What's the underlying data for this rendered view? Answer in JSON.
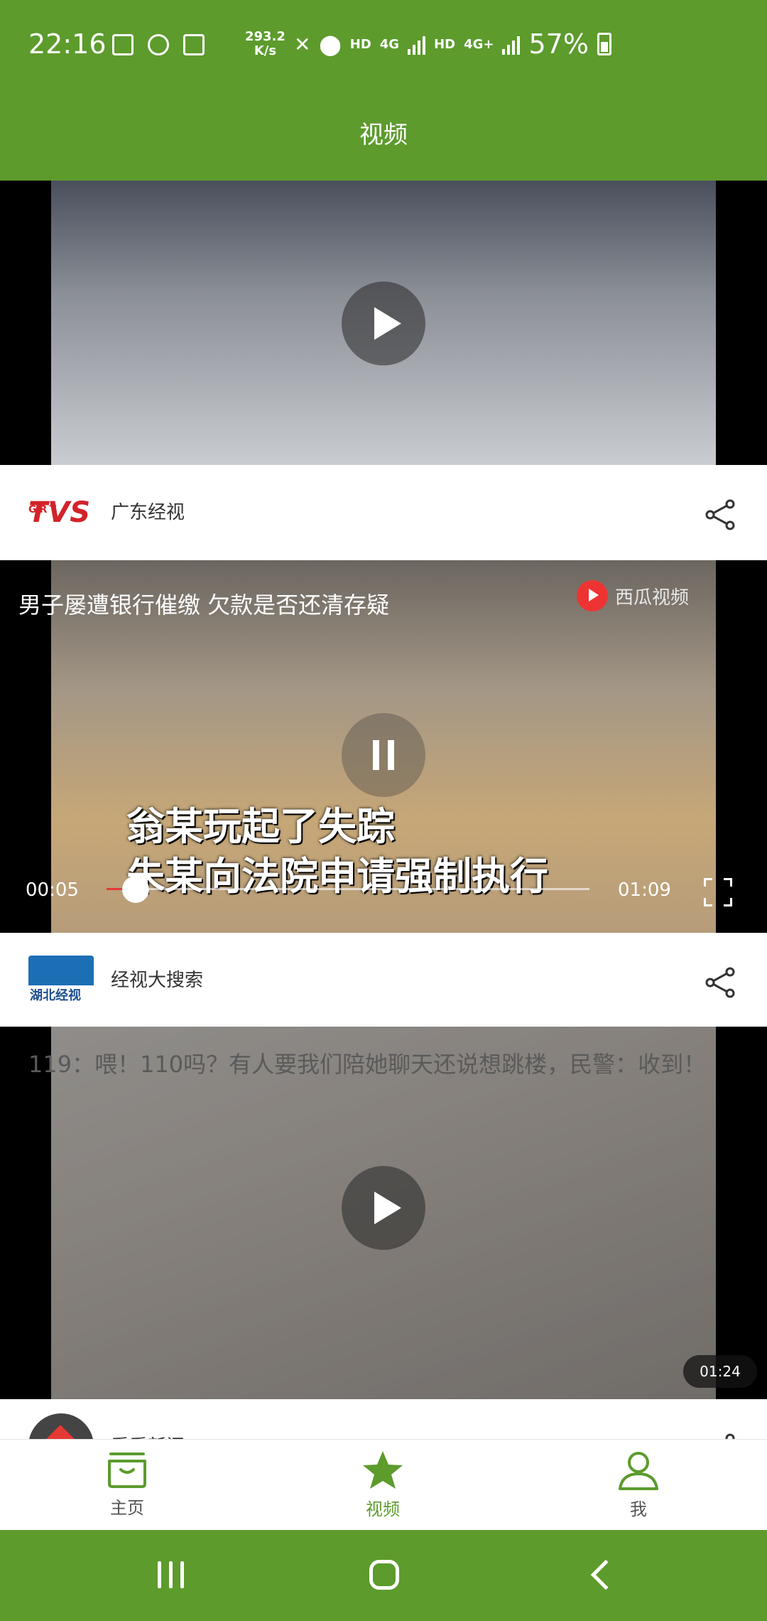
{
  "status_bar": {
    "time": "22:16",
    "net_speed_value": "293.2",
    "net_speed_unit": "K/s",
    "hd1": "HD",
    "net1": "4G",
    "hd2": "HD",
    "net2": "4G+",
    "battery": "57%"
  },
  "header": {
    "title": "视频"
  },
  "videos": [
    {
      "state": "paused-thumbnail",
      "source": "广东经视",
      "source_logo_text": "TVS",
      "source_logo_small": "GRT"
    },
    {
      "state": "playing",
      "title": "男子屡遭银行催缴 欠款是否还清存疑",
      "watermark": "西瓜视频",
      "subtitle_line1": "翁某玩起了失踪",
      "subtitle_line2": "朱某向法院申请强制执行",
      "current_time": "00:05",
      "total_time": "01:09",
      "progress": 0.06,
      "source": "经视大搜索",
      "source_logo_text": "湖北经视"
    },
    {
      "state": "paused-thumbnail",
      "title": "119：喂！110吗？有人要我们陪她聊天还说想跳楼，民警：收到！",
      "duration": "01:24",
      "source": "看看新闻"
    }
  ],
  "bottom_nav": {
    "home": "主页",
    "video": "视频",
    "me": "我"
  },
  "colors": {
    "brand_green": "#5c9b2c",
    "progress_red": "#e53935"
  },
  "icons": [
    "play-icon",
    "pause-icon",
    "share-icon",
    "fullscreen-icon",
    "home-box-icon",
    "star-icon",
    "user-icon"
  ]
}
